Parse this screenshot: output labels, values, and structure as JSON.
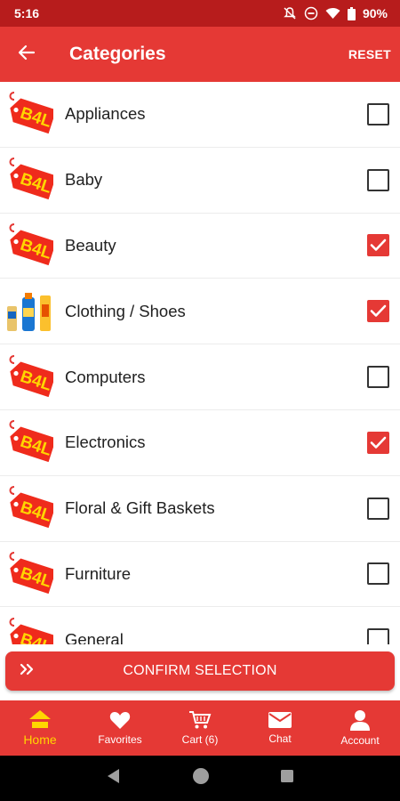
{
  "status_bar": {
    "time": "5:16",
    "battery": "90%"
  },
  "header": {
    "title": "Categories",
    "reset_label": "RESET"
  },
  "categories": [
    {
      "label": "Appliances",
      "checked": false,
      "thumb": "b4l-logo"
    },
    {
      "label": "Baby",
      "checked": false,
      "thumb": "b4l-logo"
    },
    {
      "label": "Beauty",
      "checked": true,
      "thumb": "b4l-logo"
    },
    {
      "label": "Clothing / Shoes",
      "checked": true,
      "thumb": "product-bottles"
    },
    {
      "label": "Computers",
      "checked": false,
      "thumb": "b4l-logo"
    },
    {
      "label": "Electronics",
      "checked": true,
      "thumb": "b4l-logo"
    },
    {
      "label": "Floral & Gift Baskets",
      "checked": false,
      "thumb": "b4l-logo"
    },
    {
      "label": "Furniture",
      "checked": false,
      "thumb": "b4l-logo"
    },
    {
      "label": "General",
      "checked": false,
      "thumb": "b4l-logo"
    }
  ],
  "confirm": {
    "label": "CONFIRM SELECTION"
  },
  "bottom_nav": [
    {
      "label": "Home",
      "icon": "home-icon",
      "active": true
    },
    {
      "label": "Favorites",
      "icon": "heart-icon",
      "active": false
    },
    {
      "label": "Cart (6)",
      "icon": "cart-icon",
      "active": false
    },
    {
      "label": "Chat",
      "icon": "mail-icon",
      "active": false
    },
    {
      "label": "Account",
      "icon": "person-icon",
      "active": false
    }
  ],
  "colors": {
    "primary": "#e53935",
    "status_bar": "#b71c1c",
    "active_nav": "#ffd600"
  },
  "logo_text": "B4L"
}
